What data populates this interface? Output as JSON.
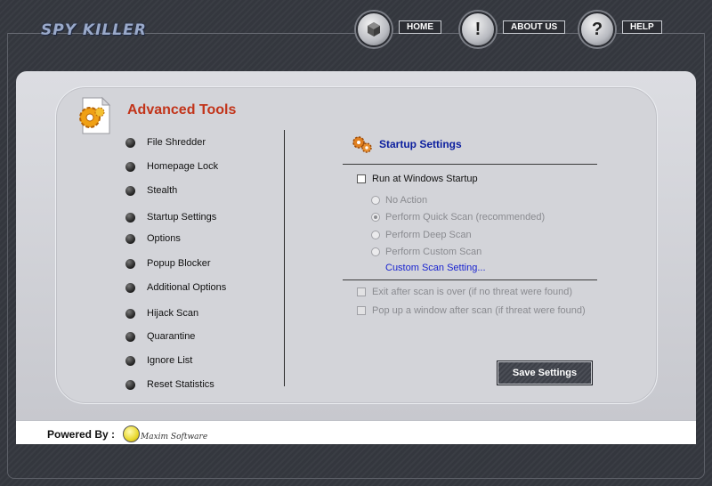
{
  "app": {
    "logo_text": "SPY KILLER"
  },
  "nav": {
    "home": {
      "label": "HOME",
      "icon": "cube-icon"
    },
    "about": {
      "label": "ABOUT US",
      "icon_text": "!"
    },
    "help": {
      "label": "HELP",
      "icon_text": "?"
    }
  },
  "advanced": {
    "title": "Advanced Tools",
    "menu": [
      {
        "label": "File Shredder"
      },
      {
        "label": "Homepage Lock"
      },
      {
        "label": "Stealth"
      },
      {
        "label": "Startup Settings"
      },
      {
        "label": "Options"
      },
      {
        "label": "Popup Blocker"
      },
      {
        "label": "Additional Options"
      },
      {
        "label": "Hijack Scan"
      },
      {
        "label": "Quarantine"
      },
      {
        "label": "Ignore List"
      },
      {
        "label": "Reset Statistics"
      }
    ]
  },
  "startup": {
    "title": "Startup Settings",
    "run_at_startup": {
      "label": "Run at Windows Startup",
      "checked": false,
      "enabled": true
    },
    "options": [
      {
        "label": "No Action",
        "checked": false
      },
      {
        "label": "Perform Quick Scan (recommended)",
        "checked": true
      },
      {
        "label": "Perform Deep Scan",
        "checked": false
      },
      {
        "label": "Perform Custom Scan",
        "checked": false
      }
    ],
    "custom_link": "Custom Scan Setting...",
    "exit_after_scan": {
      "label": "Exit after scan is over (if no threat were found)",
      "checked": false,
      "enabled": false
    },
    "popup_after_scan": {
      "label": "Pop up a window after scan (if threat were found)",
      "checked": false,
      "enabled": false
    },
    "save_button": "Save Settings"
  },
  "footer": {
    "powered_by": "Powered By :",
    "company_logo_text": "Maxim Software"
  },
  "colors": {
    "accent_title": "#c2341a",
    "section_title": "#0b1e9e",
    "link": "#1a24d0"
  }
}
